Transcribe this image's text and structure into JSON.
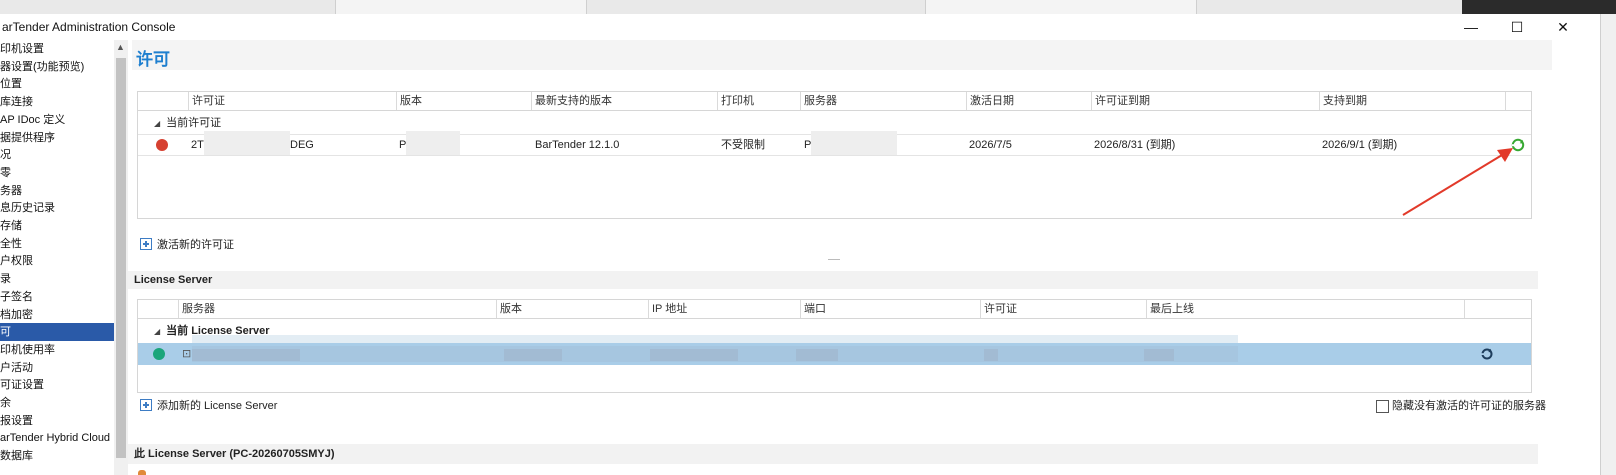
{
  "window": {
    "title": "arTender Administration Console"
  },
  "controls": {
    "minimize": "—",
    "maximize": "☐",
    "close": "✕"
  },
  "sidebar": {
    "items": [
      {
        "label": "印机设置"
      },
      {
        "label": "器设置(功能预览)"
      },
      {
        "label": "位置"
      },
      {
        "label": "库连接"
      },
      {
        "label": "AP IDoc 定义"
      },
      {
        "label": "据提供程序"
      },
      {
        "label": "况"
      },
      {
        "label": "零"
      },
      {
        "label": "务器"
      },
      {
        "label": "息历史记录"
      },
      {
        "label": "存储"
      },
      {
        "label": "全性"
      },
      {
        "label": "户权限"
      },
      {
        "label": "录"
      },
      {
        "label": "子签名"
      },
      {
        "label": "档加密"
      },
      {
        "label": "可",
        "selected": true
      },
      {
        "label": "印机使用率"
      },
      {
        "label": "户活动"
      },
      {
        "label": "可证设置"
      },
      {
        "label": "余"
      },
      {
        "label": "报设置"
      },
      {
        "label": "arTender Hybrid Cloud"
      },
      {
        "label": "数据库"
      }
    ]
  },
  "page": {
    "title": "许可"
  },
  "licenses": {
    "columns": [
      "许可证",
      "版本",
      "最新支持的版本",
      "打印机",
      "服务器",
      "激活日期",
      "许可证到期",
      "支持到期"
    ],
    "group_label": "当前许可证",
    "rows": [
      {
        "license": "2T",
        "license_tail": "DEG",
        "edition": "P",
        "latest_version": "BarTender 12.1.0",
        "printers": "不受限制",
        "server": "P",
        "activation_date": "2026/7/5",
        "license_expiry": "2026/8/31 (到期)",
        "support_expiry": "2026/9/1 (到期)",
        "status_color": "#d64131"
      }
    ],
    "activate_label": "激活新的许可证"
  },
  "license_server": {
    "section_title": "License Server",
    "columns": [
      "服务器",
      "版本",
      "IP 地址",
      "端口",
      "许可证",
      "最后上线"
    ],
    "group_label": "当前 License Server",
    "row": {
      "server_prefix": "⊡",
      "status_color": "#1aa57a"
    },
    "add_label": "添加新的 License Server",
    "hide_label": "隐藏没有激活的许可证的服务器"
  },
  "this_server": {
    "section_title": "此 License Server (PC-20260705SMYJ)"
  },
  "colors": {
    "accent": "#1e7fcf",
    "selection": "#2a5aa8",
    "row_selected": "#a9cde8",
    "arrow": "#e23a2a",
    "refresh_green": "#38a832"
  }
}
